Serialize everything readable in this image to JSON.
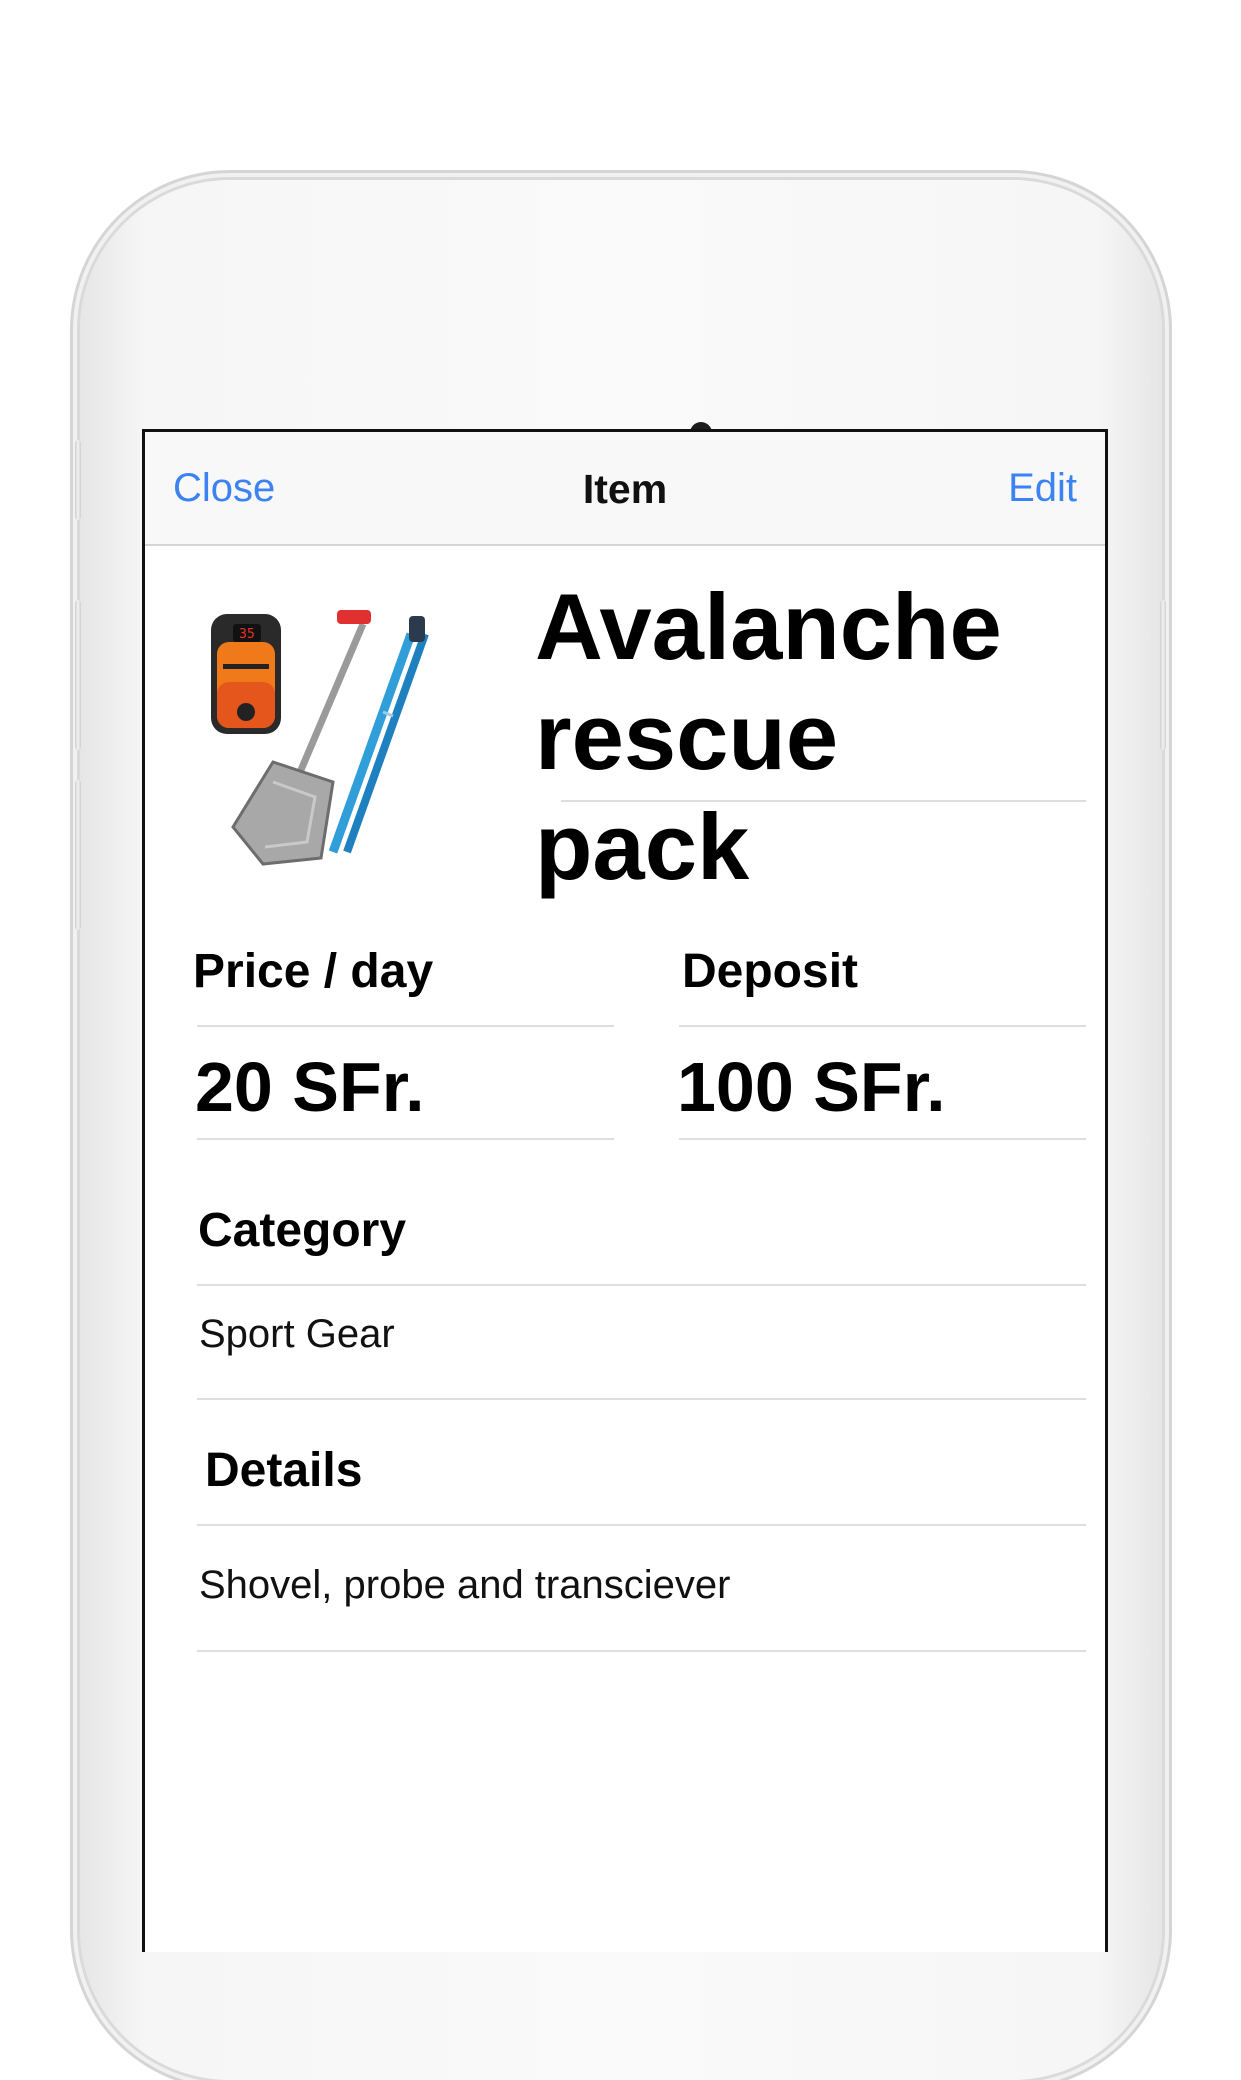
{
  "navbar": {
    "close_label": "Close",
    "title": "Item",
    "edit_label": "Edit",
    "accent_color": "#3c82f0"
  },
  "item": {
    "title_line1": "Avalanche",
    "title_line2": "rescue pack",
    "image_icon": "avalanche-gear-image"
  },
  "pricing": {
    "price_label": "Price / day",
    "price_value": "20 SFr.",
    "deposit_label": "Deposit",
    "deposit_value": "100 SFr."
  },
  "category": {
    "label": "Category",
    "value": "Sport Gear"
  },
  "details": {
    "label": "Details",
    "value": "Shovel, probe and transciever"
  }
}
